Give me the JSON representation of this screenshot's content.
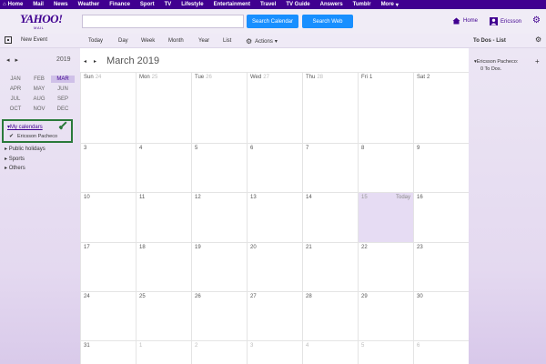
{
  "topnav": {
    "items": [
      "Home",
      "Mail",
      "News",
      "Weather",
      "Finance",
      "Sport",
      "TV",
      "Lifestyle",
      "Entertainment",
      "Travel",
      "TV Guide",
      "Answers",
      "Tumblr",
      "More"
    ]
  },
  "header": {
    "logo": "YAHOO!",
    "logo_sub": "MAIL",
    "search_calendar_label": "Search Calendar",
    "search_web_label": "Search Web",
    "home_label": "Home",
    "user_label": "Ericsson"
  },
  "toolbar": {
    "new_event": "New Event",
    "views": [
      "Today",
      "Day",
      "Week",
      "Month",
      "Year",
      "List"
    ],
    "actions": "Actions"
  },
  "sidebar": {
    "year": "2019",
    "months": [
      "JAN",
      "FEB",
      "MAR",
      "APR",
      "MAY",
      "JUN",
      "JUL",
      "AUG",
      "SEP",
      "OCT",
      "NOV",
      "DEC"
    ],
    "active_month": "MAR",
    "my_calendars": "My calendars",
    "my_calendar_item": "Ericsson Pacheco",
    "groups": [
      "Public holidays",
      "Sports",
      "Others"
    ]
  },
  "calendar": {
    "title": "March 2019",
    "weekdays": [
      {
        "name": "Sun",
        "num": "24"
      },
      {
        "name": "Mon",
        "num": "25"
      },
      {
        "name": "Tue",
        "num": "26"
      },
      {
        "name": "Wed",
        "num": "27"
      },
      {
        "name": "Thu",
        "num": "28"
      },
      {
        "name": "Fri",
        "num": "1"
      },
      {
        "name": "Sat",
        "num": "2"
      }
    ],
    "weeks": [
      [
        "3",
        "4",
        "5",
        "6",
        "7",
        "8",
        "9"
      ],
      [
        "10",
        "11",
        "12",
        "13",
        "14",
        "15",
        "16"
      ],
      [
        "17",
        "18",
        "19",
        "20",
        "21",
        "22",
        "23"
      ],
      [
        "24",
        "25",
        "26",
        "27",
        "28",
        "29",
        "30"
      ],
      [
        "31",
        "1",
        "2",
        "3",
        "4",
        "5",
        "6"
      ]
    ],
    "today_label": "Today",
    "today_date": "15"
  },
  "todo": {
    "title": "To Dos - List",
    "user": "Ericsson Pacheco:",
    "count": "0 To Dos."
  },
  "colors": {
    "brand": "#400090",
    "button": "#188fff",
    "today_bg": "#e6dcf3",
    "highlight_border": "#2a7a3a"
  }
}
